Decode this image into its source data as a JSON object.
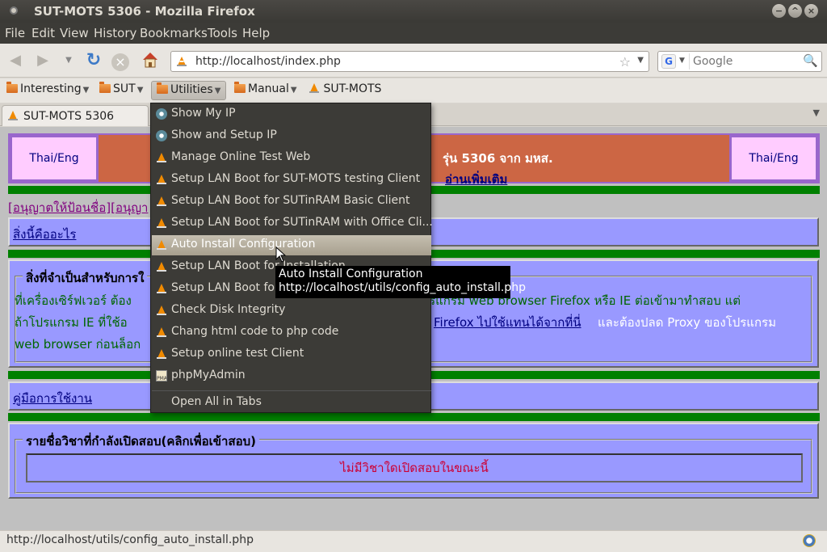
{
  "window": {
    "title": "SUT-MOTS 5306 - Mozilla Firefox",
    "buttons": [
      "minimize",
      "maximize",
      "close"
    ]
  },
  "menubar": [
    "File",
    "Edit",
    "View",
    "History",
    "Bookmarks",
    "Tools",
    "Help"
  ],
  "navbar": {
    "url": "http://localhost/index.php",
    "search_placeholder": "Google"
  },
  "bookmarks": [
    {
      "label": "Interesting",
      "type": "folder"
    },
    {
      "label": "SUT",
      "type": "folder"
    },
    {
      "label": "Utilities",
      "type": "folder",
      "active": true
    },
    {
      "label": "Manual",
      "type": "folder"
    },
    {
      "label": "SUT-MOTS",
      "type": "link"
    }
  ],
  "tab": {
    "title": "SUT-MOTS 5306"
  },
  "page": {
    "thai_eng_left": "Thai/Eng",
    "thai_eng_right": "Thai/Eng",
    "header_text": "รุ่น 5306 จาก มหส.",
    "header_link": "อ่านเพิ่มเติม",
    "permission_link": "[อนุญาตให้ป้อนชื่อ][อนุญา",
    "what_is_this": "สิ่งนี้คืออะไร",
    "requirements_title": "สิ่งที่จำเป็นสำหรับการใ",
    "requirements_line1_a": "ที่เครื่องเซิร์ฟเวอร์ ต้อง",
    "requirements_line1_b": "ใช้โปรแกรม web browser Firefox หรือ IE ต่อเข้ามาทำสอบ แต่",
    "requirements_line2_a": "ถ้าโปรแกรม IE ที่ใช้อ",
    "requirements_line2_link": "Firefox ไปใช้แทนได้จากที่นี่",
    "requirements_line2_b": "และต้องปลด Proxy ของโปรแกรม",
    "requirements_line3": "web browser ก่อนล็อก",
    "manual_link": "คู่มือการใช้งาน",
    "subjects_title": "รายชื่อวิชาที่กำลังเปิดสอบ(คลิกเพื่อเข้าสอบ)",
    "no_subjects": "ไม่มีวิชาใดเปิดสอบในขณะนี้"
  },
  "dropdown": {
    "items": [
      {
        "label": "Show My IP",
        "icon": "gear-icon"
      },
      {
        "label": "Show and Setup IP",
        "icon": "gear-icon"
      },
      {
        "label": "Manage Online Test Web",
        "icon": "vlc-cone-icon"
      },
      {
        "label": "Setup LAN Boot for SUT-MOTS testing Client",
        "icon": "vlc-cone-icon"
      },
      {
        "label": "Setup LAN Boot for SUTinRAM Basic Client",
        "icon": "vlc-cone-icon"
      },
      {
        "label": "Setup LAN Boot for SUTinRAM with Office Cli...",
        "icon": "vlc-cone-icon"
      },
      {
        "label": "Auto Install Configuration",
        "icon": "vlc-cone-icon",
        "highlighted": true
      },
      {
        "label": "Setup LAN Boot for Installation",
        "icon": "vlc-cone-icon"
      },
      {
        "label": "Setup LAN Boot for S",
        "icon": "vlc-cone-icon"
      },
      {
        "label": "Check Disk Integrity",
        "icon": "vlc-cone-icon"
      },
      {
        "label": "Chang html code to php code",
        "icon": "vlc-cone-icon"
      },
      {
        "label": "Setup online test Client",
        "icon": "vlc-cone-icon"
      },
      {
        "label": "phpMyAdmin",
        "icon": "pma-icon"
      }
    ],
    "open_all": "Open All in Tabs"
  },
  "tooltip": {
    "title": "Auto Install Configuration",
    "url": "http://localhost/utils/config_auto_install.php"
  },
  "status": {
    "text": "http://localhost/utils/config_auto_install.php"
  },
  "colors": {
    "header_bg": "#cc6644",
    "green_bar": "#008000",
    "box_bg": "#9999ff",
    "menu_bg": "#3c3b37",
    "highlight": "#b0a898"
  }
}
